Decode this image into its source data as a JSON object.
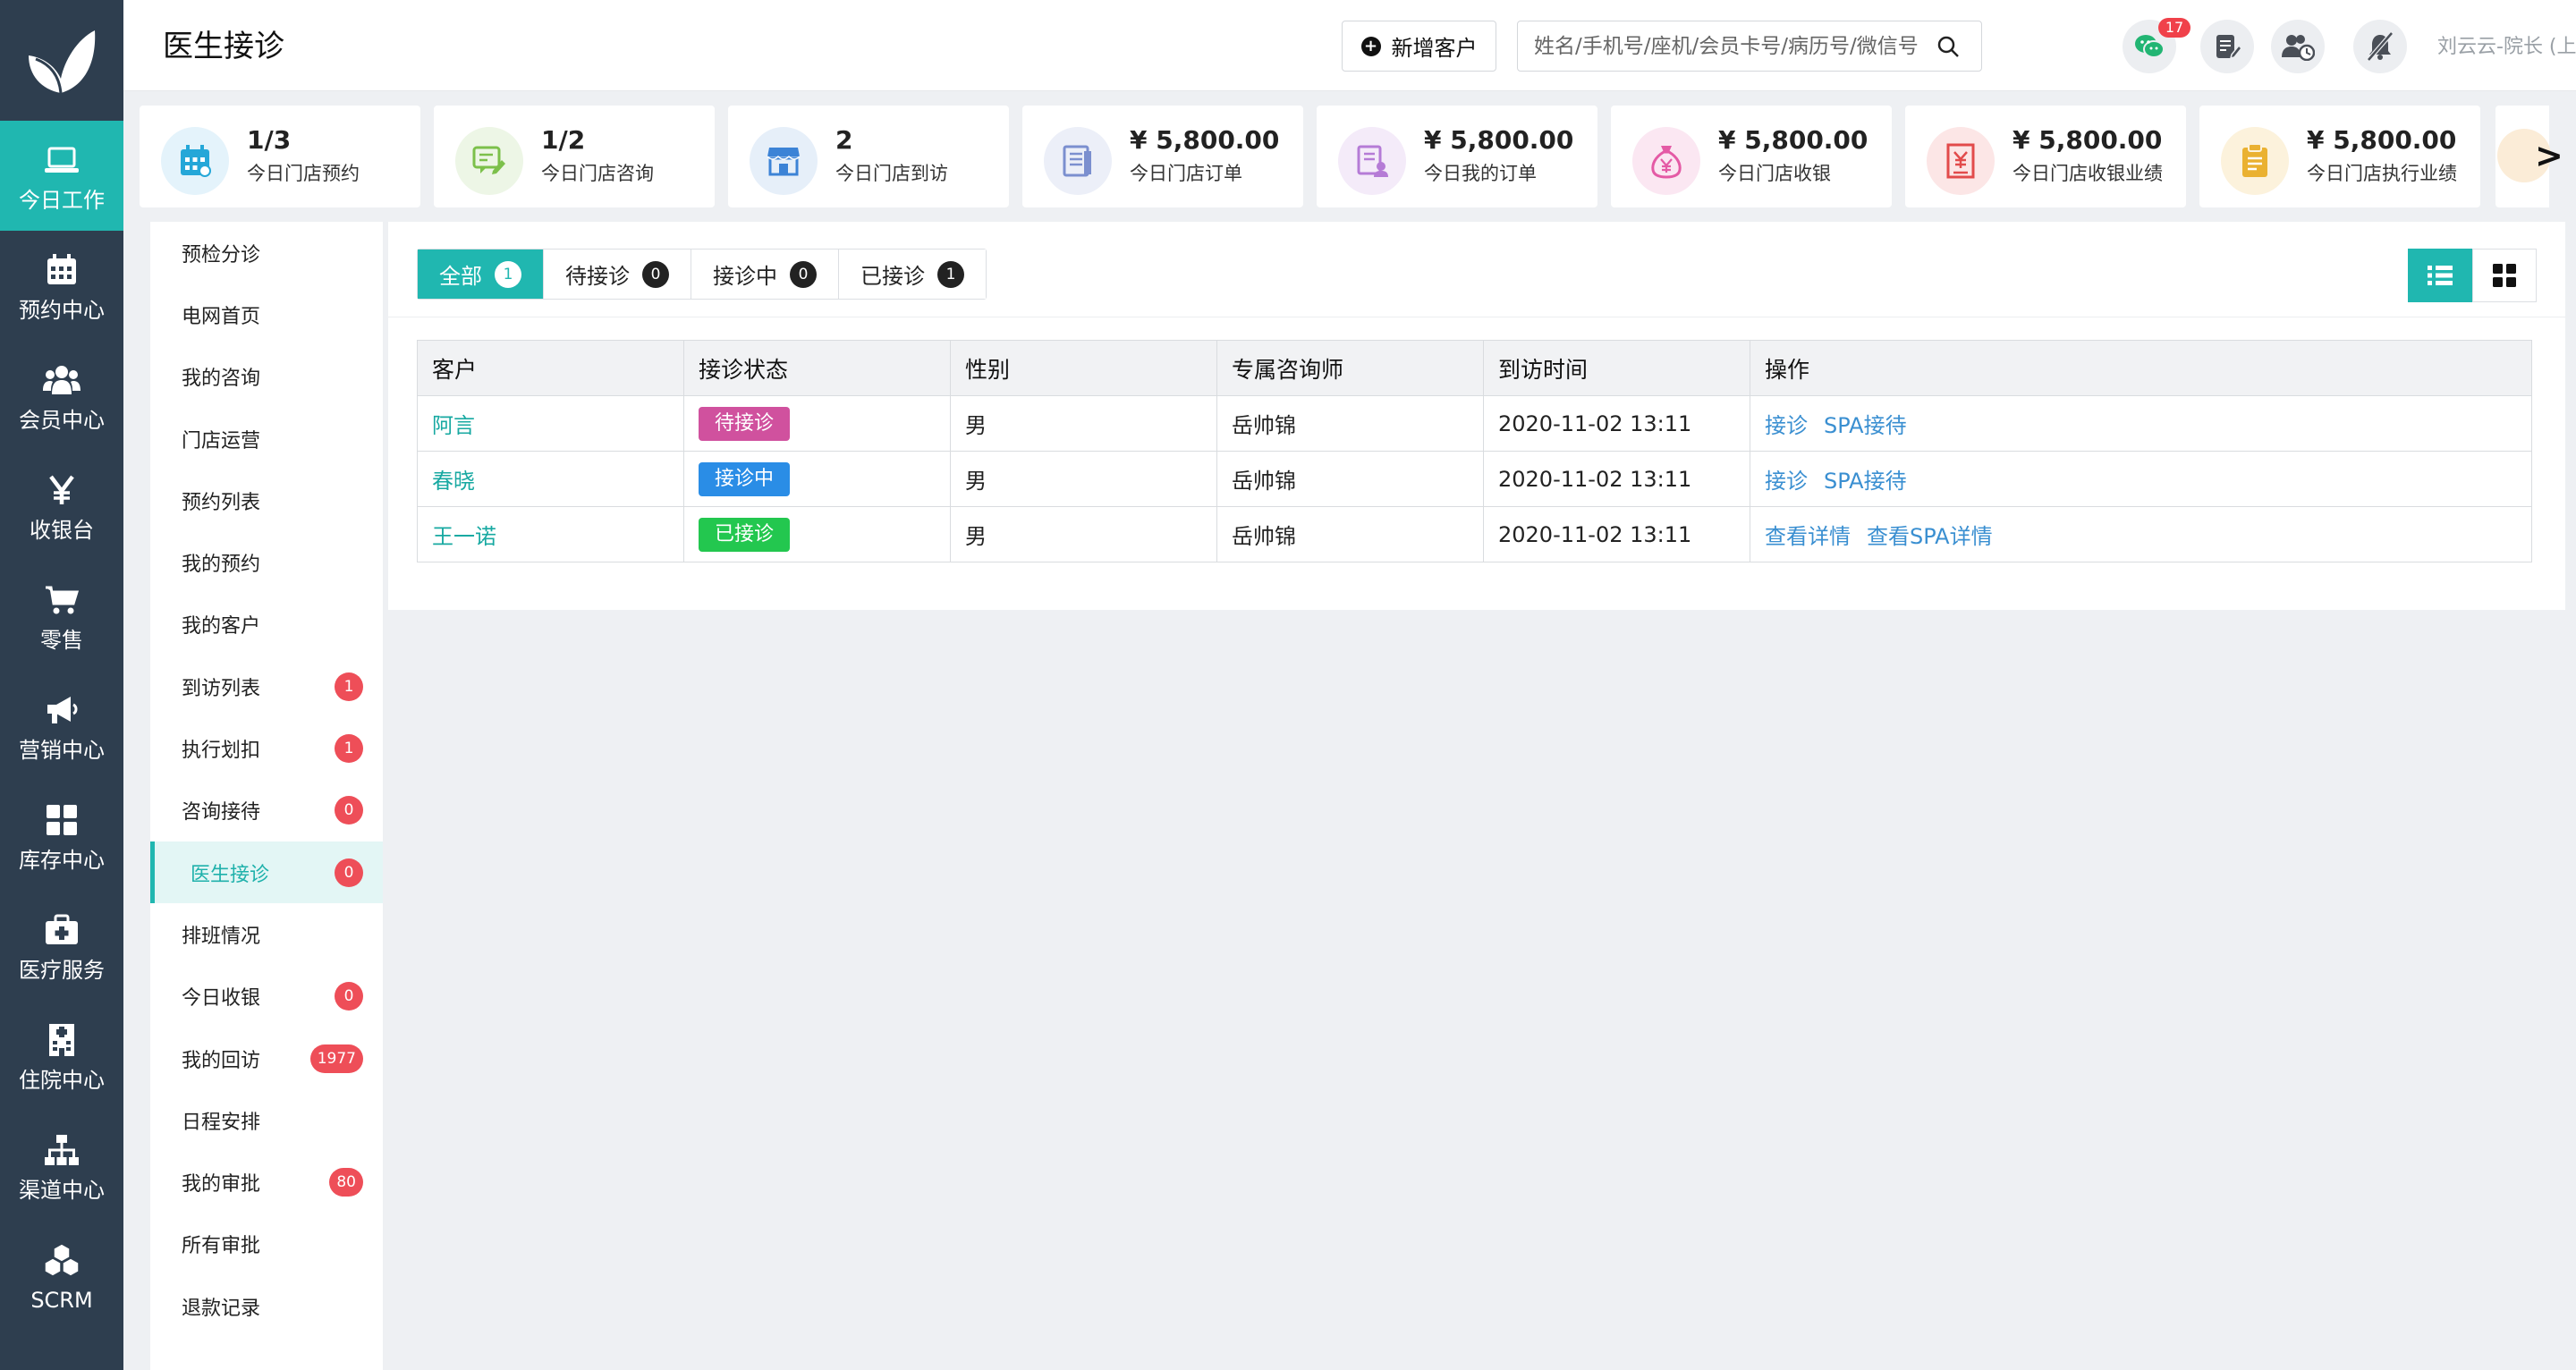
{
  "nav": {
    "items": [
      {
        "label": "今日工作",
        "icon": "laptop-icon",
        "active": true
      },
      {
        "label": "预约中心",
        "icon": "calendar-icon"
      },
      {
        "label": "会员中心",
        "icon": "users-icon"
      },
      {
        "label": "收银台",
        "icon": "yen-icon"
      },
      {
        "label": "零售",
        "icon": "cart-icon"
      },
      {
        "label": "营销中心",
        "icon": "megaphone-icon"
      },
      {
        "label": "库存中心",
        "icon": "grid-icon"
      },
      {
        "label": "医疗服务",
        "icon": "medkit-icon"
      },
      {
        "label": "住院中心",
        "icon": "hospital-icon"
      },
      {
        "label": "渠道中心",
        "icon": "sitemap-icon"
      },
      {
        "label": "SCRM",
        "icon": "cubes-icon"
      }
    ]
  },
  "header": {
    "title": "医生接诊",
    "new_customer_label": "新增客户",
    "search_placeholder": "姓名/手机号/座机/会员卡号/病历号/微信号",
    "wechat_badge": "17",
    "user": "刘云云-院长 (上海张江店)"
  },
  "stats": [
    {
      "value": "1/3",
      "label": "今日门店预约",
      "icon": "calendar-icon",
      "color": "#25a7d8",
      "bg": "#e4f3fb"
    },
    {
      "value": "1/2",
      "label": "今日门店咨询",
      "icon": "chat-edit-icon",
      "color": "#7cc04b",
      "bg": "#edf6e6"
    },
    {
      "value": "2",
      "label": "今日门店到访",
      "icon": "store-icon",
      "color": "#3c83d6",
      "bg": "#e6eff9"
    },
    {
      "value": "¥ 5,800.00",
      "label": "今日门店订单",
      "icon": "order-icon",
      "color": "#7b8fcf",
      "bg": "#eceff8"
    },
    {
      "value": "¥ 5,800.00",
      "label": "今日我的订单",
      "icon": "my-order-icon",
      "color": "#b57bd6",
      "bg": "#f4ebf9"
    },
    {
      "value": "¥ 5,800.00",
      "label": "今日门店收银",
      "icon": "money-bag-icon",
      "color": "#e45aa5",
      "bg": "#fbe7f2"
    },
    {
      "value": "¥ 5,800.00",
      "label": "今日门店收银业绩",
      "icon": "receipt-icon",
      "color": "#e24b4b",
      "bg": "#fce6e6"
    },
    {
      "value": "¥ 5,800.00",
      "label": "今日门店执行业绩",
      "icon": "clipboard-icon",
      "color": "#eab131",
      "bg": "#fcf2dc"
    }
  ],
  "stats_next": ">",
  "submenu": [
    {
      "label": "预检分诊"
    },
    {
      "label": "电网首页"
    },
    {
      "label": "我的咨询"
    },
    {
      "label": "门店运营"
    },
    {
      "label": "预约列表"
    },
    {
      "label": "我的预约"
    },
    {
      "label": "我的客户"
    },
    {
      "label": "到访列表",
      "badge": "1"
    },
    {
      "label": "执行划扣",
      "badge": "1"
    },
    {
      "label": "咨询接待",
      "badge": "0"
    },
    {
      "label": "医生接诊",
      "badge": "0",
      "active": true
    },
    {
      "label": "排班情况"
    },
    {
      "label": "今日收银",
      "badge": "0"
    },
    {
      "label": "我的回访",
      "badge": "1977"
    },
    {
      "label": "日程安排"
    },
    {
      "label": "我的审批",
      "badge": "80"
    },
    {
      "label": "所有审批"
    },
    {
      "label": "退款记录"
    }
  ],
  "tabs": [
    {
      "label": "全部",
      "count": "1",
      "active": true
    },
    {
      "label": "待接诊",
      "count": "0"
    },
    {
      "label": "接诊中",
      "count": "0"
    },
    {
      "label": "已接诊",
      "count": "1"
    }
  ],
  "table": {
    "columns": [
      "客户",
      "接诊状态",
      "性别",
      "专属咨询师",
      "到访时间",
      "操作"
    ],
    "rows": [
      {
        "customer": "阿言",
        "status": "待接诊",
        "status_color": "#d0519e",
        "gender": "男",
        "consultant": "岳帅锦",
        "time": "2020-11-02 13:11",
        "actions": [
          "接诊",
          "SPA接待"
        ]
      },
      {
        "customer": "春晓",
        "status": "接诊中",
        "status_color": "#2a8de6",
        "gender": "男",
        "consultant": "岳帅锦",
        "time": "2020-11-02 13:11",
        "actions": [
          "接诊",
          "SPA接待"
        ]
      },
      {
        "customer": "王一诺",
        "status": "已接诊",
        "status_color": "#23c74f",
        "gender": "男",
        "consultant": "岳帅锦",
        "time": "2020-11-02 13:11",
        "actions": [
          "查看详情",
          "查看SPA详情"
        ]
      }
    ]
  }
}
